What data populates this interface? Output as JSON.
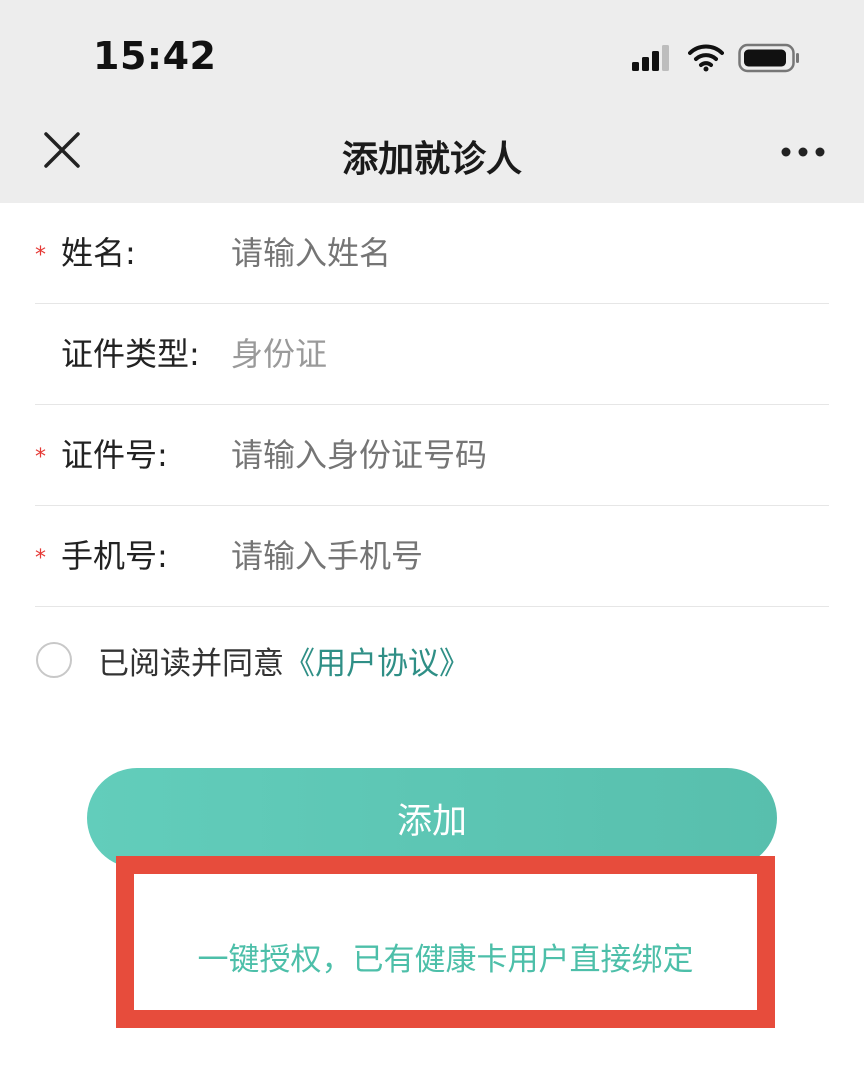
{
  "status_bar": {
    "time": "15:42",
    "icons": [
      "signal-icon",
      "wifi-icon",
      "battery-icon"
    ]
  },
  "nav": {
    "title": "添加就诊人",
    "close_icon": "close-icon",
    "more_icon": "more-icon"
  },
  "form": {
    "name": {
      "required_mark": "*",
      "label": "姓名:",
      "placeholder": "请输入姓名"
    },
    "id_type": {
      "label": "证件类型:",
      "value": "身份证"
    },
    "id_number": {
      "required_mark": "*",
      "label": "证件号:",
      "placeholder": "请输入身份证号码"
    },
    "phone": {
      "required_mark": "*",
      "label": "手机号:",
      "placeholder": "请输入手机号"
    }
  },
  "agreement": {
    "text": "已阅读并同意",
    "link": "《用户协议》",
    "checked": false
  },
  "actions": {
    "add_label": "添加",
    "authorize_label": "一键授权，已有健康卡用户直接绑定"
  },
  "colors": {
    "accent": "#5cc6b3",
    "link": "#2f8f86",
    "required": "#e53935",
    "highlight_border": "#e74c3c",
    "header_bg": "#ededed"
  }
}
